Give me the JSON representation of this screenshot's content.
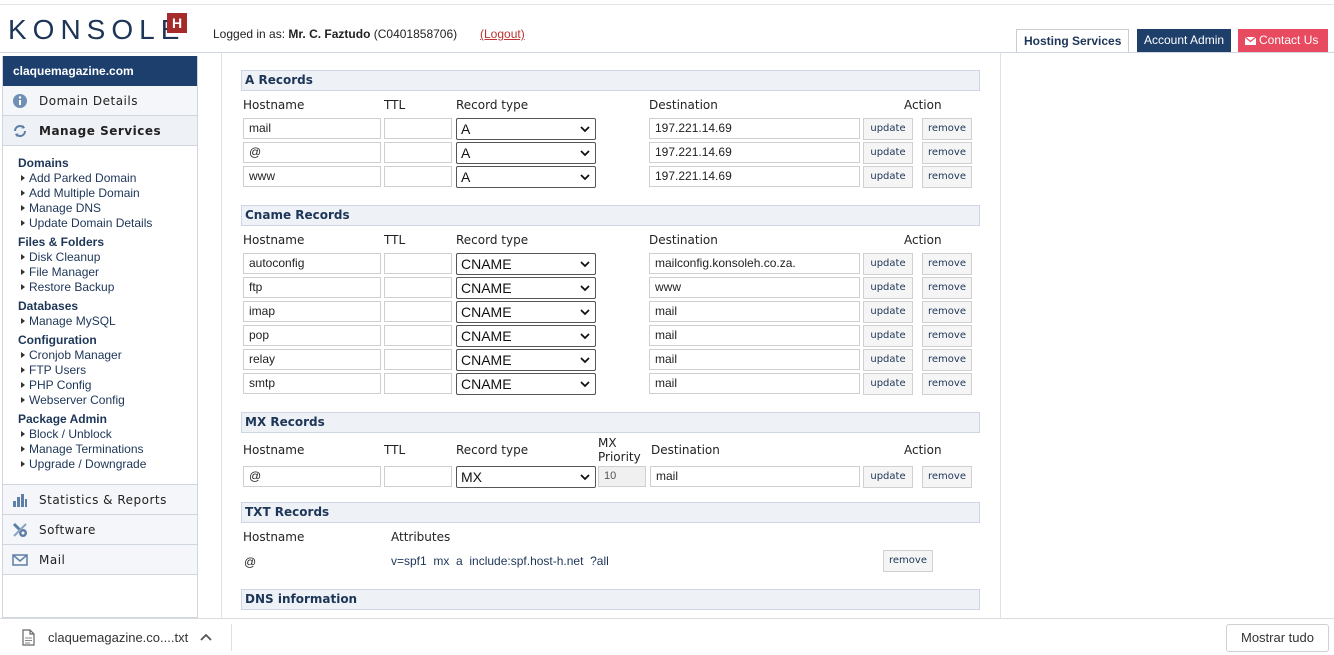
{
  "header": {
    "logo_text": "KONSOLE",
    "logo_mark": "H",
    "logged_in_prefix": "Logged in as:",
    "user_name": "Mr. C. Faztudo",
    "account_id": "(C0401858706)",
    "logout_label": "(Logout)",
    "tabs": [
      "Hosting Services",
      "Account Admin",
      "Contact Us"
    ]
  },
  "sidebar": {
    "domain": "claquemagazine.com",
    "items_top": [
      "Domain Details",
      "Manage Services"
    ],
    "groups": [
      {
        "title": "Domains",
        "items": [
          "Add Parked Domain",
          "Add Multiple Domain",
          "Manage DNS",
          "Update Domain Details"
        ]
      },
      {
        "title": "Files & Folders",
        "items": [
          "Disk Cleanup",
          "File Manager",
          "Restore Backup"
        ]
      },
      {
        "title": "Databases",
        "items": [
          "Manage MySQL"
        ]
      },
      {
        "title": "Configuration",
        "items": [
          "Cronjob Manager",
          "FTP Users",
          "PHP Config",
          "Webserver Config"
        ]
      },
      {
        "title": "Package Admin",
        "items": [
          "Block / Unblock",
          "Manage Terminations",
          "Upgrade / Downgrade"
        ]
      }
    ],
    "items_bottom": [
      "Statistics & Reports",
      "Software",
      "Mail"
    ]
  },
  "columns": {
    "hostname": "Hostname",
    "ttl": "TTL",
    "record_type": "Record type",
    "destination": "Destination",
    "action": "Action",
    "mx_priority_1": "MX",
    "mx_priority_2": "Priority",
    "attributes": "Attributes"
  },
  "buttons": {
    "update": "update",
    "remove": "remove"
  },
  "a_records": {
    "title": "A Records",
    "rows": [
      {
        "hostname": "mail",
        "ttl": "",
        "type": "A",
        "destination": "197.221.14.69"
      },
      {
        "hostname": "@",
        "ttl": "",
        "type": "A",
        "destination": "197.221.14.69"
      },
      {
        "hostname": "www",
        "ttl": "",
        "type": "A",
        "destination": "197.221.14.69"
      }
    ]
  },
  "cname_records": {
    "title": "Cname Records",
    "rows": [
      {
        "hostname": "autoconfig",
        "ttl": "",
        "type": "CNAME",
        "destination": "mailconfig.konsoleh.co.za."
      },
      {
        "hostname": "ftp",
        "ttl": "",
        "type": "CNAME",
        "destination": "www"
      },
      {
        "hostname": "imap",
        "ttl": "",
        "type": "CNAME",
        "destination": "mail"
      },
      {
        "hostname": "pop",
        "ttl": "",
        "type": "CNAME",
        "destination": "mail"
      },
      {
        "hostname": "relay",
        "ttl": "",
        "type": "CNAME",
        "destination": "mail"
      },
      {
        "hostname": "smtp",
        "ttl": "",
        "type": "CNAME",
        "destination": "mail"
      }
    ]
  },
  "mx_records": {
    "title": "MX Records",
    "rows": [
      {
        "hostname": "@",
        "ttl": "",
        "type": "MX",
        "priority": "10",
        "destination": "mail"
      }
    ]
  },
  "txt_records": {
    "title": "TXT Records",
    "rows": [
      {
        "hostname": "@",
        "attributes": "v=spf1  mx  a  include:spf.host-h.net  ?all"
      }
    ]
  },
  "dns_info": {
    "title": "DNS information"
  },
  "download_bar": {
    "file_name": "claquemagazine.co....txt",
    "show_all": "Mostrar tudo"
  },
  "colors": {
    "brand_navy": "#1d3f6e",
    "brand_red": "#a52a2a",
    "contact_pink": "#e84a5f"
  }
}
